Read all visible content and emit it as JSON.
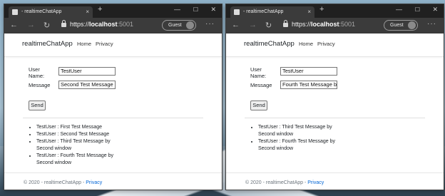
{
  "windows": [
    {
      "tab_title": "- realtimeChatApp",
      "url": {
        "scheme": "https://",
        "host": "localhost",
        "port": ":5001"
      },
      "profile_label": "Guest",
      "brand": "realtimeChatApp",
      "nav": {
        "home": "Home",
        "privacy": "Privacy"
      },
      "form": {
        "user_label": "User Name:",
        "user_value": "TestUser",
        "message_label": "Message",
        "message_value": "Second Test Message",
        "send_label": "Send"
      },
      "messages": [
        "TestUser : First Test Message",
        "TestUser : Second Test Message",
        "TestUser : Third Test Message by Second window",
        "TestUser : Fourth Test Message by Second window"
      ],
      "footer": {
        "text": "© 2020 - realtimeChatApp - ",
        "link": "Privacy"
      }
    },
    {
      "tab_title": "- realtimeChatApp",
      "url": {
        "scheme": "https://",
        "host": "localhost",
        "port": ":5001"
      },
      "profile_label": "Guest",
      "brand": "realtimeChatApp",
      "nav": {
        "home": "Home",
        "privacy": "Privacy"
      },
      "form": {
        "user_label": "User Name:",
        "user_value": "TestUser",
        "message_label": "Message",
        "message_value": "Fourth Test Message by S",
        "send_label": "Send"
      },
      "messages": [
        "TestUser : Third Test Message by Second window",
        "TestUser : Fourth Test Message by Second window"
      ],
      "footer": {
        "text": "© 2020 - realtimeChatApp - ",
        "link": "Privacy"
      }
    }
  ],
  "icons": {
    "tab_close": "×",
    "new_tab": "+",
    "minimize": "—",
    "maximize": "☐",
    "close": "✕",
    "back": "←",
    "forward": "→",
    "refresh": "↻",
    "more": "···"
  }
}
